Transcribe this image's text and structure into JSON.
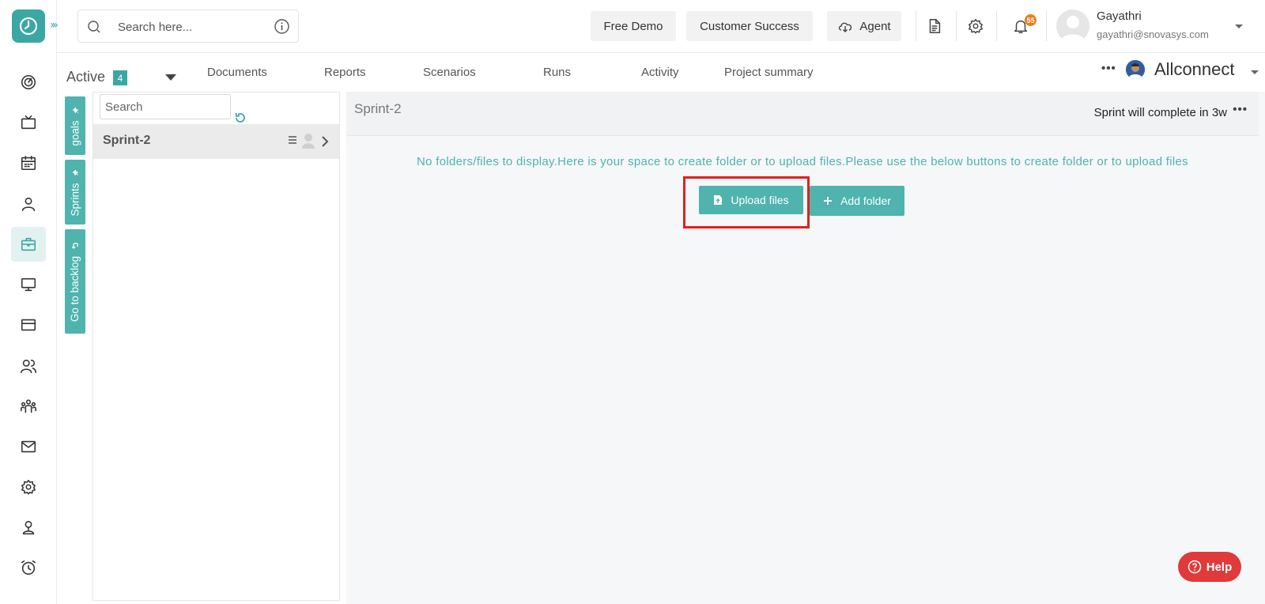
{
  "header": {
    "search_placeholder": "Search here...",
    "buttons": {
      "free_demo": "Free Demo",
      "customer_success": "Customer Success",
      "agent": "Agent"
    },
    "notification_count": "55",
    "user": {
      "name": "Gayathri",
      "email": "gayathri@snovasys.com"
    }
  },
  "subnav": {
    "active_label": "Active",
    "active_count": "4",
    "tabs": [
      "Documents",
      "Reports",
      "Scenarios",
      "Runs",
      "Activity",
      "Project summary"
    ],
    "more": "•••",
    "project_name": "Allconnect"
  },
  "vertical_tabs": {
    "goals": "goals",
    "sprints": "Sprints",
    "backlog": "Go to backlog"
  },
  "sprint_list": {
    "search_placeholder": "Search",
    "items": [
      {
        "name": "Sprint-2"
      }
    ]
  },
  "main": {
    "sprint_title": "Sprint-2",
    "sprint_status": "Sprint will complete in 3w",
    "more": "•••",
    "empty_message": "No folders/files to display.Here is your space to create folder or to upload files.Please use the below buttons to create folder or to upload files",
    "upload_label": "Upload files",
    "add_folder_label": "Add folder"
  },
  "help_label": "Help",
  "colors": {
    "accent": "#3aa7a5",
    "highlight": "#e0201d",
    "help": "#e03a3a",
    "badge": "#f07b1d"
  }
}
